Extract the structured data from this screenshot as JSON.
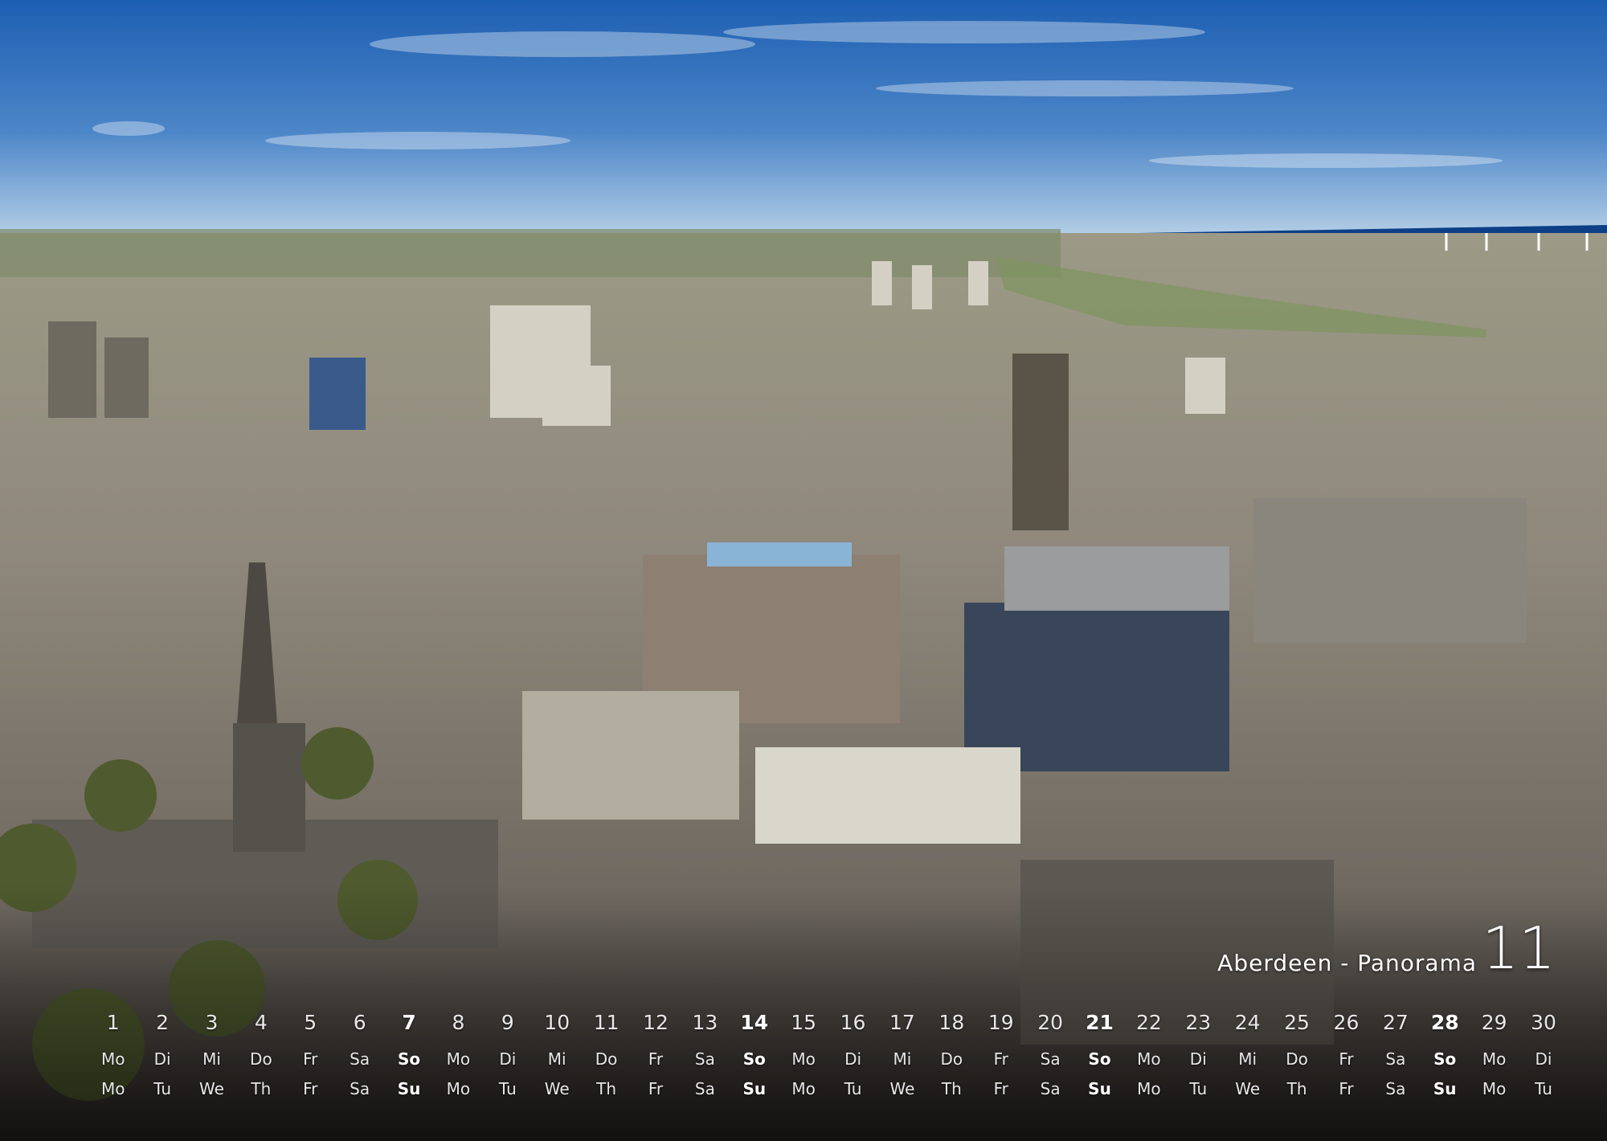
{
  "caption": "Aberdeen - Panorama",
  "month": "11",
  "days": [
    {
      "d": "1",
      "de": "Mo",
      "en": "Mo",
      "sun": false
    },
    {
      "d": "2",
      "de": "Di",
      "en": "Tu",
      "sun": false
    },
    {
      "d": "3",
      "de": "Mi",
      "en": "We",
      "sun": false
    },
    {
      "d": "4",
      "de": "Do",
      "en": "Th",
      "sun": false
    },
    {
      "d": "5",
      "de": "Fr",
      "en": "Fr",
      "sun": false
    },
    {
      "d": "6",
      "de": "Sa",
      "en": "Sa",
      "sun": false
    },
    {
      "d": "7",
      "de": "So",
      "en": "Su",
      "sun": true
    },
    {
      "d": "8",
      "de": "Mo",
      "en": "Mo",
      "sun": false
    },
    {
      "d": "9",
      "de": "Di",
      "en": "Tu",
      "sun": false
    },
    {
      "d": "10",
      "de": "Mi",
      "en": "We",
      "sun": false
    },
    {
      "d": "11",
      "de": "Do",
      "en": "Th",
      "sun": false
    },
    {
      "d": "12",
      "de": "Fr",
      "en": "Fr",
      "sun": false
    },
    {
      "d": "13",
      "de": "Sa",
      "en": "Sa",
      "sun": false
    },
    {
      "d": "14",
      "de": "So",
      "en": "Su",
      "sun": true
    },
    {
      "d": "15",
      "de": "Mo",
      "en": "Mo",
      "sun": false
    },
    {
      "d": "16",
      "de": "Di",
      "en": "Tu",
      "sun": false
    },
    {
      "d": "17",
      "de": "Mi",
      "en": "We",
      "sun": false
    },
    {
      "d": "18",
      "de": "Do",
      "en": "Th",
      "sun": false
    },
    {
      "d": "19",
      "de": "Fr",
      "en": "Fr",
      "sun": false
    },
    {
      "d": "20",
      "de": "Sa",
      "en": "Sa",
      "sun": false
    },
    {
      "d": "21",
      "de": "So",
      "en": "Su",
      "sun": true
    },
    {
      "d": "22",
      "de": "Mo",
      "en": "Mo",
      "sun": false
    },
    {
      "d": "23",
      "de": "Di",
      "en": "Tu",
      "sun": false
    },
    {
      "d": "24",
      "de": "Mi",
      "en": "We",
      "sun": false
    },
    {
      "d": "25",
      "de": "Do",
      "en": "Th",
      "sun": false
    },
    {
      "d": "26",
      "de": "Fr",
      "en": "Fr",
      "sun": false
    },
    {
      "d": "27",
      "de": "Sa",
      "en": "Sa",
      "sun": false
    },
    {
      "d": "28",
      "de": "So",
      "en": "Su",
      "sun": true
    },
    {
      "d": "29",
      "de": "Mo",
      "en": "Mo",
      "sun": false
    },
    {
      "d": "30",
      "de": "Di",
      "en": "Tu",
      "sun": false
    }
  ],
  "colors": {
    "sky_top": "#1f63b5",
    "sky_bottom": "#a9c8e4",
    "sea": "#0d3f86",
    "city": "#8c8579",
    "dark_stone": "#4a4843"
  }
}
